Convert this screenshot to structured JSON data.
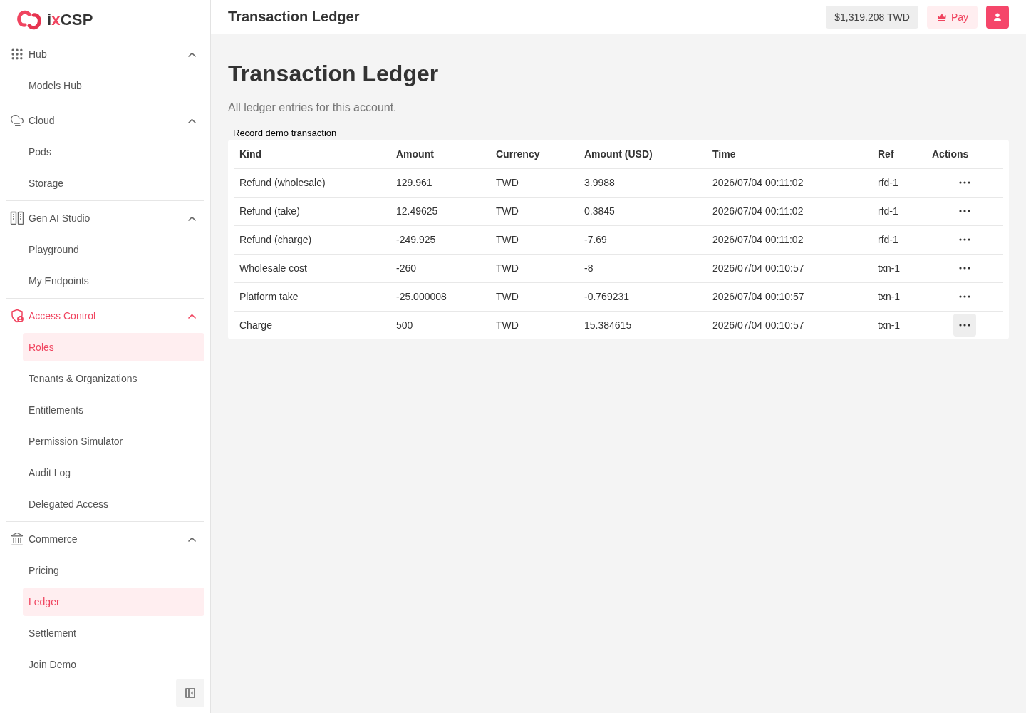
{
  "sidebar": {
    "logo": {
      "parts": [
        {
          "text": "i",
          "accent": false
        },
        {
          "text": "x",
          "accent": true
        },
        {
          "text": "CSP",
          "accent": false
        }
      ]
    },
    "groups": [
      {
        "label": "Hub",
        "active": false,
        "expanded": true,
        "items": [
          {
            "label": "Models Hub",
            "selected": false
          }
        ]
      },
      {
        "label": "Cloud",
        "active": false,
        "expanded": true,
        "items": [
          {
            "label": "Pods",
            "selected": false
          },
          {
            "label": "Storage",
            "selected": false
          }
        ]
      },
      {
        "label": "Gen AI Studio",
        "active": false,
        "expanded": true,
        "items": [
          {
            "label": "Playground",
            "selected": false
          },
          {
            "label": "My Endpoints",
            "selected": false
          }
        ]
      },
      {
        "label": "Access Control",
        "active": true,
        "expanded": true,
        "items": [
          {
            "label": "Roles",
            "selected": true
          },
          {
            "label": "Tenants & Organizations",
            "selected": false
          },
          {
            "label": "Entitlements",
            "selected": false
          },
          {
            "label": "Permission Simulator",
            "selected": false
          },
          {
            "label": "Audit Log",
            "selected": false
          },
          {
            "label": "Delegated Access",
            "selected": false
          }
        ]
      },
      {
        "label": "Commerce",
        "active": false,
        "expanded": true,
        "items": [
          {
            "label": "Pricing",
            "selected": false
          },
          {
            "label": "Ledger",
            "selected": true
          },
          {
            "label": "Settlement",
            "selected": false
          },
          {
            "label": "Join Demo",
            "selected": false
          }
        ]
      }
    ]
  },
  "header": {
    "title": "Transaction Ledger",
    "balance": "$1,319.208 TWD",
    "pay_button": "Pay"
  },
  "page": {
    "title": "Transaction Ledger",
    "subtitle": "All ledger entries for this account.",
    "record_button": "Record demo transaction"
  },
  "table": {
    "columns": [
      "Kind",
      "Amount",
      "Currency",
      "Amount (USD)",
      "Time",
      "Ref",
      "Actions"
    ],
    "rows": [
      {
        "cells": [
          "Refund (wholesale)",
          "129.961",
          "TWD",
          "3.9988",
          "2026/07/04 00:11:02",
          "rfd-1"
        ],
        "menu_hovered": false
      },
      {
        "cells": [
          "Refund (take)",
          "12.49625",
          "TWD",
          "0.3845",
          "2026/07/04 00:11:02",
          "rfd-1"
        ],
        "menu_hovered": false
      },
      {
        "cells": [
          "Refund (charge)",
          "-249.925",
          "TWD",
          "-7.69",
          "2026/07/04 00:11:02",
          "rfd-1"
        ],
        "menu_hovered": false
      },
      {
        "cells": [
          "Wholesale cost",
          "-260",
          "TWD",
          "-8",
          "2026/07/04 00:10:57",
          "txn-1"
        ],
        "menu_hovered": false
      },
      {
        "cells": [
          "Platform take",
          "-25.000008",
          "TWD",
          "-0.769231",
          "2026/07/04 00:10:57",
          "txn-1"
        ],
        "menu_hovered": false
      },
      {
        "cells": [
          "Charge",
          "500",
          "TWD",
          "15.384615",
          "2026/07/04 00:10:57",
          "txn-1"
        ],
        "menu_hovered": true
      }
    ]
  }
}
